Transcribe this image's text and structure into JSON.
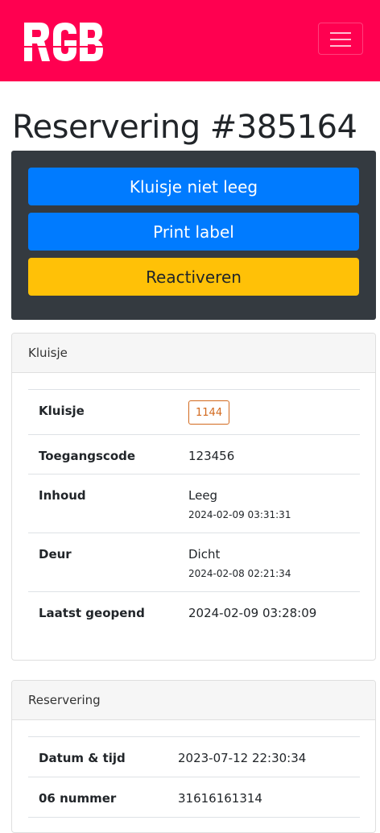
{
  "navbar": {
    "logo_text": "RGB",
    "menu_icon": "hamburger-menu-icon"
  },
  "page": {
    "title": "Reservering #385164"
  },
  "actions": {
    "locker_not_empty": "Kluisje niet leeg",
    "print_label": "Print label",
    "reactivate": "Reactiveren"
  },
  "locker_card": {
    "header": "Kluisje",
    "rows": [
      {
        "label": "Kluisje",
        "value": "1144"
      },
      {
        "label": "Toegangscode",
        "value": "123456"
      },
      {
        "label": "Inhoud",
        "value": "Leeg",
        "timestamp": "2024-02-09 03:31:31"
      },
      {
        "label": "Deur",
        "value": "Dicht",
        "timestamp": "2024-02-08 02:21:34"
      },
      {
        "label": "Laatst geopend",
        "value": "2024-02-09 03:28:09"
      }
    ]
  },
  "reservation_card": {
    "header": "Reservering",
    "rows": [
      {
        "label": "Datum & tijd",
        "value": "2023-07-12 22:30:34"
      },
      {
        "label": "06 nummer",
        "value": "31616161314"
      }
    ]
  },
  "colors": {
    "brand": "#ff0050",
    "primary": "#007bff",
    "warning": "#ffc107",
    "dark_panel": "#343a40",
    "badge_outline": "#d2691e"
  }
}
